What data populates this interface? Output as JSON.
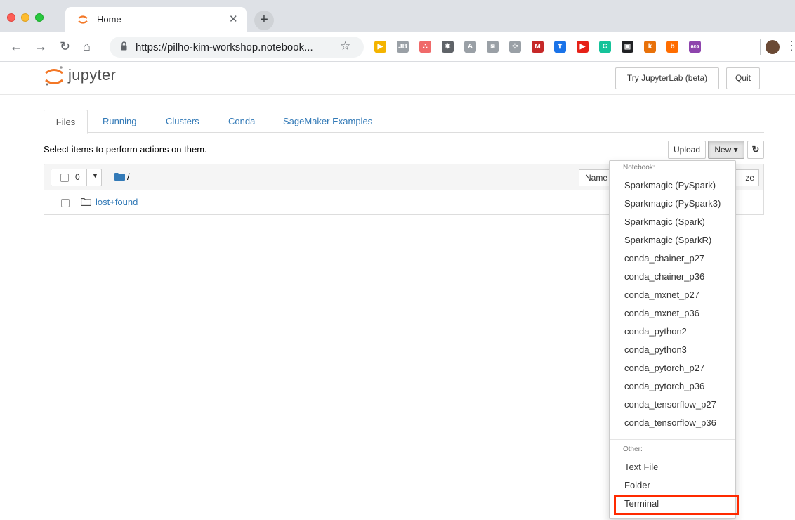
{
  "browser": {
    "tab_title": "Home",
    "url": "https://pilho-kim-workshop.notebook...",
    "extensions": [
      {
        "icon": "ext-play-icon",
        "color": "#f4b400",
        "glyph": "▶"
      },
      {
        "icon": "ext-jb-icon",
        "color": "#9aa0a6",
        "glyph": "JB"
      },
      {
        "icon": "ext-asana-icon",
        "color": "#f06a6a",
        "glyph": "∴"
      },
      {
        "icon": "ext-gear-icon",
        "color": "#5f6368",
        "glyph": "✹"
      },
      {
        "icon": "ext-angular-icon",
        "color": "#9aa0a6",
        "glyph": "A"
      },
      {
        "icon": "ext-rss-icon",
        "color": "#9aa0a6",
        "glyph": "◙"
      },
      {
        "icon": "ext-puzzle-icon",
        "color": "#9aa0a6",
        "glyph": "✣"
      },
      {
        "icon": "ext-m-icon",
        "color": "#c62828",
        "glyph": "M"
      },
      {
        "icon": "ext-arrow-icon",
        "color": "#1a73e8",
        "glyph": "⬆"
      },
      {
        "icon": "ext-youtube-icon",
        "color": "#e62117",
        "glyph": "▶"
      },
      {
        "icon": "ext-grammarly-icon",
        "color": "#15c39a",
        "glyph": "G"
      },
      {
        "icon": "ext-ghost-icon",
        "color": "#202124",
        "glyph": "▣"
      },
      {
        "icon": "ext-k-icon",
        "color": "#e8710a",
        "glyph": "k"
      },
      {
        "icon": "ext-b-icon",
        "color": "#ff6d00",
        "glyph": "b"
      },
      {
        "icon": "ext-aea-icon",
        "color": "#8e44ad",
        "glyph": "aea"
      }
    ]
  },
  "header": {
    "logo_text": "jupyter",
    "try_lab": "Try JupyterLab (beta)",
    "quit": "Quit"
  },
  "tabs": [
    "Files",
    "Running",
    "Clusters",
    "Conda",
    "SageMaker Examples"
  ],
  "files": {
    "hint": "Select items to perform actions on them.",
    "upload": "Upload",
    "new": "New ▾",
    "selected_count": "0",
    "path": "/",
    "name_col": "Name",
    "size_col": "ze",
    "rows": [
      {
        "name": "lost+found"
      }
    ]
  },
  "new_menu": {
    "notebook_header": "Notebook:",
    "kernels": [
      "Sparkmagic (PySpark)",
      "Sparkmagic (PySpark3)",
      "Sparkmagic (Spark)",
      "Sparkmagic (SparkR)",
      "conda_chainer_p27",
      "conda_chainer_p36",
      "conda_mxnet_p27",
      "conda_mxnet_p36",
      "conda_python2",
      "conda_python3",
      "conda_pytorch_p27",
      "conda_pytorch_p36",
      "conda_tensorflow_p27",
      "conda_tensorflow_p36"
    ],
    "other_header": "Other:",
    "other": [
      "Text File",
      "Folder",
      "Terminal"
    ],
    "highlight_color": "#ff2a00"
  }
}
